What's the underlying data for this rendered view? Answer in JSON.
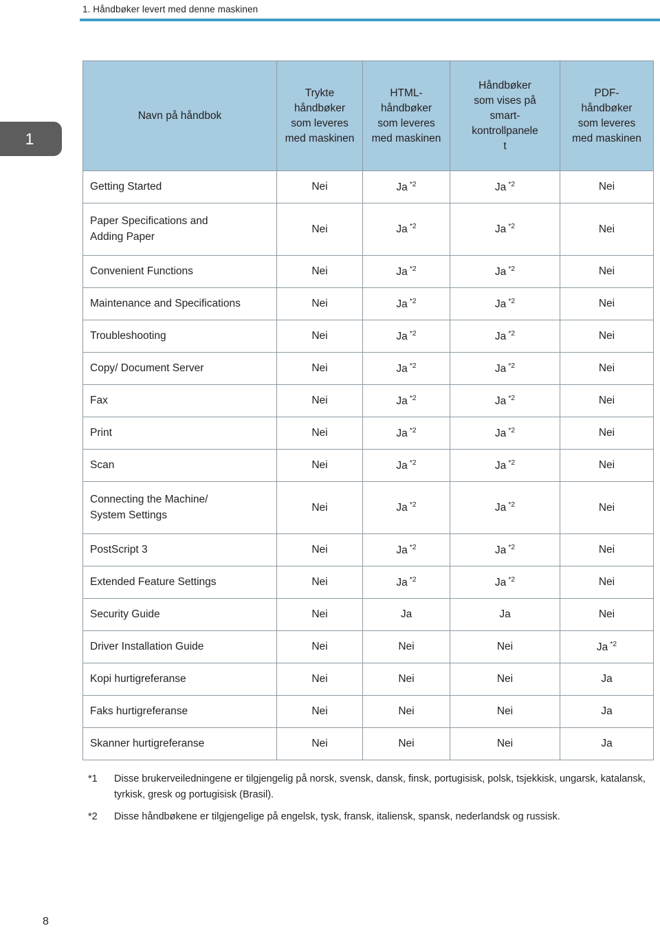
{
  "header": {
    "running_title": "1. Håndbøker levert med denne maskinen",
    "rule_color": "#3f9dc8"
  },
  "chapter_tab": {
    "number": "1",
    "background_color": "#5d5d5d",
    "text_color": "#ffffff"
  },
  "table": {
    "header_background": "#a7cbdf",
    "border_color": "#8d9aa3",
    "columns": [
      {
        "key": "name",
        "label": "Navn på håndbok"
      },
      {
        "key": "print",
        "label": "Trykte håndbøker som leveres med maskinen"
      },
      {
        "key": "html",
        "label": "HTML-håndbøker som leveres med maskinen"
      },
      {
        "key": "smart",
        "label": "Håndbøker som vises på smart-kontrollpanelet"
      },
      {
        "key": "pdf",
        "label": "PDF-håndbøker som leveres med maskinen"
      }
    ],
    "column_label_lines": {
      "name": [
        "Navn på håndbok"
      ],
      "print": [
        "Trykte",
        "håndbøker",
        "som leveres",
        "med maskinen"
      ],
      "html": [
        "HTML-",
        "håndbøker",
        "som leveres",
        "med maskinen"
      ],
      "smart": [
        "Håndbøker",
        "som vises på",
        "smart-",
        "kontrollpanele",
        "t"
      ],
      "pdf": [
        "PDF-",
        "håndbøker",
        "som leveres",
        "med maskinen"
      ]
    },
    "rows": [
      {
        "name": "Getting Started",
        "name_line2": "",
        "print": "Nei",
        "print_fn": "",
        "html": "Ja",
        "html_fn": "*2",
        "smart": "Ja",
        "smart_fn": "*2",
        "pdf": "Nei",
        "pdf_fn": ""
      },
      {
        "name": "Paper Specifications and",
        "name_line2": "Adding Paper",
        "print": "Nei",
        "print_fn": "",
        "html": "Ja",
        "html_fn": "*2",
        "smart": "Ja",
        "smart_fn": "*2",
        "pdf": "Nei",
        "pdf_fn": ""
      },
      {
        "name": "Convenient Functions",
        "name_line2": "",
        "print": "Nei",
        "print_fn": "",
        "html": "Ja",
        "html_fn": "*2",
        "smart": "Ja",
        "smart_fn": "*2",
        "pdf": "Nei",
        "pdf_fn": ""
      },
      {
        "name": "Maintenance and Specifications",
        "name_line2": "",
        "print": "Nei",
        "print_fn": "",
        "html": "Ja",
        "html_fn": "*2",
        "smart": "Ja",
        "smart_fn": "*2",
        "pdf": "Nei",
        "pdf_fn": ""
      },
      {
        "name": "Troubleshooting",
        "name_line2": "",
        "print": "Nei",
        "print_fn": "",
        "html": "Ja",
        "html_fn": "*2",
        "smart": "Ja",
        "smart_fn": "*2",
        "pdf": "Nei",
        "pdf_fn": ""
      },
      {
        "name": "Copy/ Document Server",
        "name_line2": "",
        "print": "Nei",
        "print_fn": "",
        "html": "Ja",
        "html_fn": "*2",
        "smart": "Ja",
        "smart_fn": "*2",
        "pdf": "Nei",
        "pdf_fn": ""
      },
      {
        "name": "Fax",
        "name_line2": "",
        "print": "Nei",
        "print_fn": "",
        "html": "Ja",
        "html_fn": "*2",
        "smart": "Ja",
        "smart_fn": "*2",
        "pdf": "Nei",
        "pdf_fn": ""
      },
      {
        "name": "Print",
        "name_line2": "",
        "print": "Nei",
        "print_fn": "",
        "html": "Ja",
        "html_fn": "*2",
        "smart": "Ja",
        "smart_fn": "*2",
        "pdf": "Nei",
        "pdf_fn": ""
      },
      {
        "name": "Scan",
        "name_line2": "",
        "print": "Nei",
        "print_fn": "",
        "html": "Ja",
        "html_fn": "*2",
        "smart": "Ja",
        "smart_fn": "*2",
        "pdf": "Nei",
        "pdf_fn": ""
      },
      {
        "name": "Connecting the Machine/",
        "name_line2": "System Settings",
        "print": "Nei",
        "print_fn": "",
        "html": "Ja",
        "html_fn": "*2",
        "smart": "Ja",
        "smart_fn": "*2",
        "pdf": "Nei",
        "pdf_fn": ""
      },
      {
        "name": "PostScript 3",
        "name_line2": "",
        "print": "Nei",
        "print_fn": "",
        "html": "Ja",
        "html_fn": "*2",
        "smart": "Ja",
        "smart_fn": "*2",
        "pdf": "Nei",
        "pdf_fn": ""
      },
      {
        "name": "Extended Feature Settings",
        "name_line2": "",
        "print": "Nei",
        "print_fn": "",
        "html": "Ja",
        "html_fn": "*2",
        "smart": "Ja",
        "smart_fn": "*2",
        "pdf": "Nei",
        "pdf_fn": ""
      },
      {
        "name": "Security Guide",
        "name_line2": "",
        "print": "Nei",
        "print_fn": "",
        "html": "Ja",
        "html_fn": "",
        "smart": "Ja",
        "smart_fn": "",
        "pdf": "Nei",
        "pdf_fn": ""
      },
      {
        "name": "Driver Installation Guide",
        "name_line2": "",
        "print": "Nei",
        "print_fn": "",
        "html": "Nei",
        "html_fn": "",
        "smart": "Nei",
        "smart_fn": "",
        "pdf": "Ja",
        "pdf_fn": "*2"
      },
      {
        "name": "Kopi hurtigreferanse",
        "name_line2": "",
        "print": "Nei",
        "print_fn": "",
        "html": "Nei",
        "html_fn": "",
        "smart": "Nei",
        "smart_fn": "",
        "pdf": "Ja",
        "pdf_fn": ""
      },
      {
        "name": "Faks hurtigreferanse",
        "name_line2": "",
        "print": "Nei",
        "print_fn": "",
        "html": "Nei",
        "html_fn": "",
        "smart": "Nei",
        "smart_fn": "",
        "pdf": "Ja",
        "pdf_fn": ""
      },
      {
        "name": "Skanner hurtigreferanse",
        "name_line2": "",
        "print": "Nei",
        "print_fn": "",
        "html": "Nei",
        "html_fn": "",
        "smart": "Nei",
        "smart_fn": "",
        "pdf": "Ja",
        "pdf_fn": ""
      }
    ]
  },
  "footnotes": [
    {
      "marker": "*1",
      "text": "Disse brukerveiledningene er tilgjengelig på norsk, svensk, dansk, finsk, portugisisk, polsk, tsjekkisk, ungarsk, katalansk, tyrkisk, gresk og portugisisk (Brasil)."
    },
    {
      "marker": "*2",
      "text": "Disse håndbøkene er tilgjengelige på engelsk, tysk, fransk, italiensk, spansk, nederlandsk og russisk."
    }
  ],
  "page_number": "8"
}
